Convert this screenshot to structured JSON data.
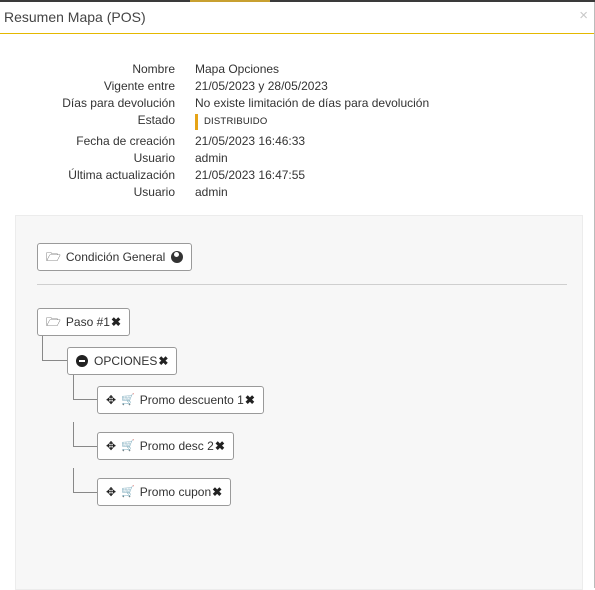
{
  "modal": {
    "title": "Resumen Mapa (POS)",
    "close_glyph": "×"
  },
  "info": {
    "rows": [
      {
        "label": "Nombre",
        "value": "Mapa Opciones"
      },
      {
        "label": "Vigente entre",
        "value": "21/05/2023 y 28/05/2023"
      },
      {
        "label": "Días para devolución",
        "value": "No existe limitación de días para devolución"
      },
      {
        "label": "Estado",
        "value": "DISTRIBUIDO"
      },
      {
        "label": "Fecha de creación",
        "value": "21/05/2023 16:46:33"
      },
      {
        "label": "Usuario",
        "value": "admin"
      },
      {
        "label": "Última actualización",
        "value": "21/05/2023 16:47:55"
      },
      {
        "label": "Usuario",
        "value": "admin"
      }
    ],
    "status_color": "#e6a417"
  },
  "tree": {
    "general": {
      "label": "Condición General",
      "icon": "folder-open-icon",
      "trailing_icon": "globe-icon"
    },
    "step": {
      "label": "Paso #1",
      "icon": "folder-open-icon",
      "remove_glyph": "✖"
    },
    "group": {
      "label": "OPCIONES",
      "icon": "minus-circle-icon",
      "remove_glyph": "✖"
    },
    "promos": [
      {
        "label": "Promo descuento 1",
        "remove_glyph": "✖"
      },
      {
        "label": "Promo desc 2",
        "remove_glyph": "✖"
      },
      {
        "label": "Promo cupon",
        "remove_glyph": "✖"
      }
    ]
  },
  "colors": {
    "header_border": "#e4b800",
    "panel_bg": "#f7f7f7"
  }
}
